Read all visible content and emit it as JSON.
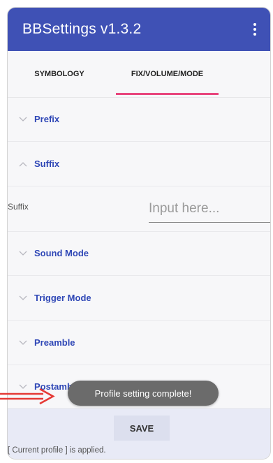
{
  "app": {
    "title": "BBSettings v1.3.2",
    "menu_icon": "more-vert-icon"
  },
  "tabs": [
    {
      "label": "SYMBOLOGY",
      "selected": false
    },
    {
      "label": "FIX/VOLUME/MODE",
      "selected": true
    }
  ],
  "sections": {
    "prefix": {
      "label": "Prefix",
      "expanded": false
    },
    "suffix": {
      "label": "Suffix",
      "expanded": true
    },
    "sound_mode": {
      "label": "Sound Mode",
      "expanded": false
    },
    "trigger_mode": {
      "label": "Trigger Mode",
      "expanded": false
    },
    "preamble": {
      "label": "Preamble",
      "expanded": false
    },
    "postamble": {
      "label": "Postamble",
      "expanded": false
    }
  },
  "suffix_field": {
    "label": "Suffix",
    "value": "",
    "placeholder": "Input here..."
  },
  "toast": {
    "message": "Profile setting complete!"
  },
  "footer": {
    "save_label": "SAVE",
    "status": "[ Current profile ] is applied."
  },
  "colors": {
    "app_bar": "#3f51b5",
    "section_label": "#2f47b6",
    "tab_indicator": "#e8467d",
    "toast_bg": "#6b6b6b",
    "footer_bg": "#e8eaf6",
    "annotation_arrow": "#e53935"
  },
  "icons": {
    "collapsed": "chevron-down-icon",
    "expanded": "chevron-up-icon",
    "annotation": "red-arrow-icon"
  }
}
